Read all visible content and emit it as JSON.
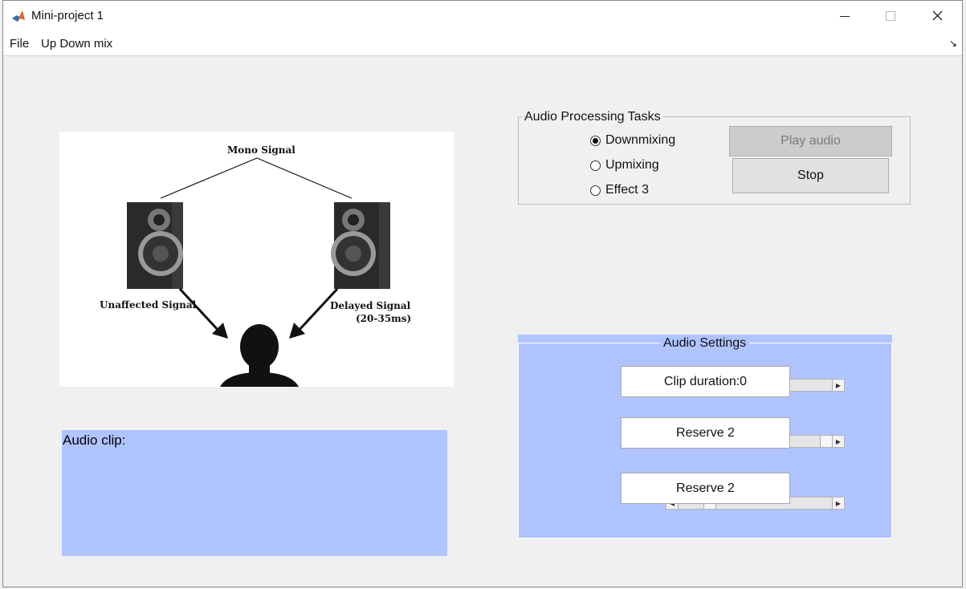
{
  "window": {
    "title": "Mini-project 1"
  },
  "menubar": {
    "items": [
      "File",
      "Up Down mix"
    ]
  },
  "illustration": {
    "mono_label": "Mono Signal",
    "unaffected_label": "Unaffected Signal",
    "delayed_label": "Delayed Signal",
    "delay_range": "(20-35ms)"
  },
  "audio_clip": {
    "label": "Audio clip:"
  },
  "tasks": {
    "title": "Audio Processing Tasks",
    "options": [
      "Downmixing",
      "Upmixing",
      "Effect 3"
    ],
    "selected": "Downmixing",
    "play_label": "Play audio",
    "stop_label": "Stop"
  },
  "settings": {
    "title": "Audio Settings",
    "rows": [
      {
        "label": "Clip duration:0",
        "slider_value": 1.0
      },
      {
        "label": "Reserve 2",
        "slider_value": 0.9
      },
      {
        "label": "Reserve 2",
        "slider_value": 0.2
      }
    ]
  },
  "colors": {
    "panel_blue": "#b0c4ff",
    "window_bg": "#f0f0f0"
  }
}
